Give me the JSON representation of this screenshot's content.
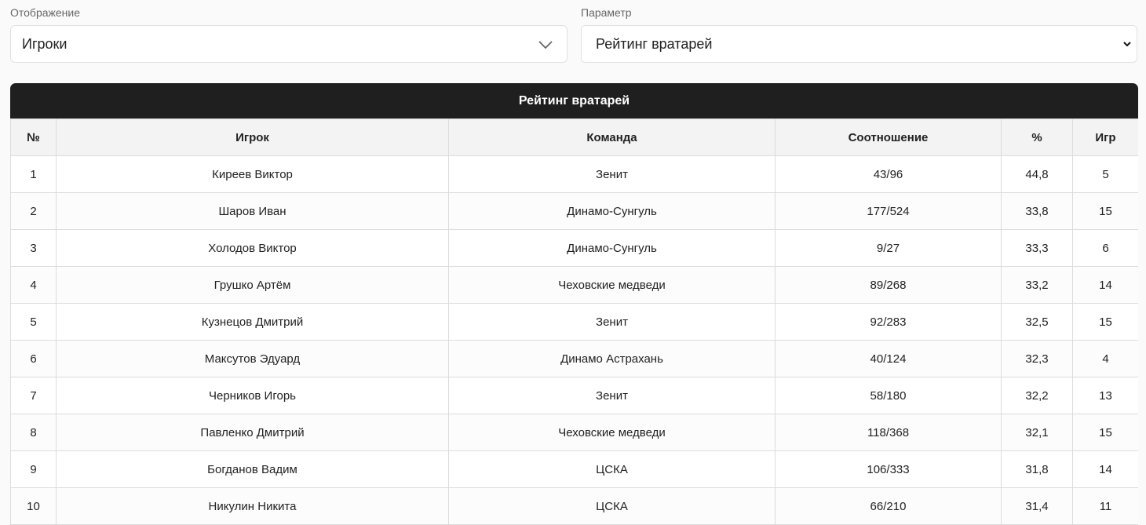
{
  "filters": {
    "display": {
      "label": "Отображение",
      "value": "Игроки"
    },
    "parameter": {
      "label": "Параметр",
      "value": "Рейтинг вратарей"
    }
  },
  "table": {
    "title": "Рейтинг вратарей",
    "columns": [
      "№",
      "Игрок",
      "Команда",
      "Соотношение",
      "%",
      "Игр"
    ],
    "rows": [
      [
        "1",
        "Киреев Виктор",
        "Зенит",
        "43/96",
        "44,8",
        "5"
      ],
      [
        "2",
        "Шаров Иван",
        "Динамо-Сунгуль",
        "177/524",
        "33,8",
        "15"
      ],
      [
        "3",
        "Холодов Виктор",
        "Динамо-Сунгуль",
        "9/27",
        "33,3",
        "6"
      ],
      [
        "4",
        "Грушко Артём",
        "Чеховские медведи",
        "89/268",
        "33,2",
        "14"
      ],
      [
        "5",
        "Кузнецов Дмитрий",
        "Зенит",
        "92/283",
        "32,5",
        "15"
      ],
      [
        "6",
        "Максутов Эдуард",
        "Динамо Астрахань",
        "40/124",
        "32,3",
        "4"
      ],
      [
        "7",
        "Черников Игорь",
        "Зенит",
        "58/180",
        "32,2",
        "13"
      ],
      [
        "8",
        "Павленко Дмитрий",
        "Чеховские медведи",
        "118/368",
        "32,1",
        "15"
      ],
      [
        "9",
        "Богданов Вадим",
        "ЦСКА",
        "106/333",
        "31,8",
        "14"
      ],
      [
        "10",
        "Никулин Никита",
        "ЦСКА",
        "66/210",
        "31,4",
        "11"
      ]
    ]
  }
}
